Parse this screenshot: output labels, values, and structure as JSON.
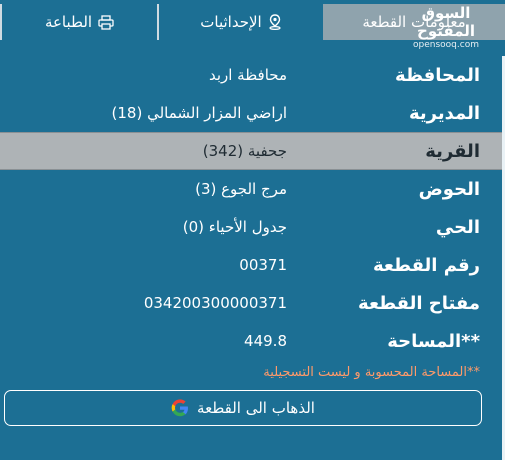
{
  "tabs": {
    "info": "معلومات القطعة",
    "coords": "الإحداثيات",
    "print": "الطباعة"
  },
  "watermark": {
    "main": "السوق المفتوح",
    "sub": "opensooq.com"
  },
  "rows": [
    {
      "label": "المحافظة",
      "value": "محافظة اربد"
    },
    {
      "label": "المديرية",
      "value": "اراضي المزار الشمالي (18)"
    },
    {
      "label": "القرية",
      "value": "جحفية (342)"
    },
    {
      "label": "الحوض",
      "value": "مرج الجوع (3)"
    },
    {
      "label": "الحي",
      "value": "جدول الأحياء (0)"
    },
    {
      "label": "رقم القطعة",
      "value": "00371"
    },
    {
      "label": "مفتاح القطعة",
      "value": "034200300000371"
    },
    {
      "label": "**المساحة",
      "value": "449.8"
    }
  ],
  "note": "**المساحة المحسوبة و ليست التسجيلية",
  "goto_button": "الذهاب الى القطعة",
  "colors": {
    "background": "#1c6f94",
    "active_tab": "#8fa3ad",
    "highlight_row": "#aeb3b6",
    "note": "#ff9a6a"
  }
}
